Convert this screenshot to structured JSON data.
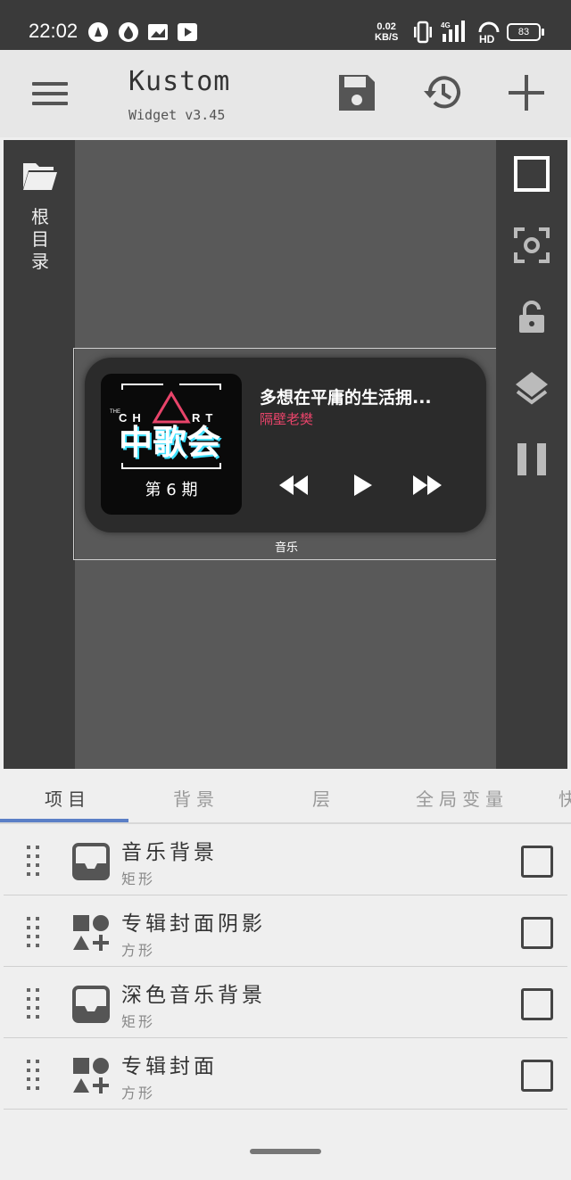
{
  "status_bar": {
    "time": "22:02",
    "net_speed_value": "0.02",
    "net_speed_unit": "KB/S",
    "battery": "83",
    "signal_label": "4G",
    "hd_label": "HD"
  },
  "app_bar": {
    "title": "Kustom",
    "subtitle": "Widget v3.45",
    "icons": [
      "menu-icon",
      "save-icon",
      "history-icon",
      "add-icon"
    ]
  },
  "editor": {
    "root_label": "根目录",
    "widget": {
      "cover_brand": "THE CHART",
      "cover_title": "中歌会",
      "cover_episode": "第 6 期",
      "song_title": "多想在平庸的生活拥...",
      "artist": "隔壁老樊",
      "label": "音乐"
    },
    "right_tools": [
      "select-box-icon",
      "focus-icon",
      "lock-icon",
      "layers-icon",
      "pause-icon"
    ]
  },
  "tabs": [
    {
      "label": "项目",
      "active": true
    },
    {
      "label": "背景",
      "active": false
    },
    {
      "label": "层",
      "active": false
    },
    {
      "label": "全局变量",
      "active": false
    },
    {
      "label": "快",
      "active": false
    }
  ],
  "items": [
    {
      "name": "音乐背景",
      "type": "矩形",
      "icon": "rectangle-icon"
    },
    {
      "name": "专辑封面阴影",
      "type": "方形",
      "icon": "shapes-icon"
    },
    {
      "name": "深色音乐背景",
      "type": "矩形",
      "icon": "rectangle-icon"
    },
    {
      "name": "专辑封面",
      "type": "方形",
      "icon": "shapes-icon"
    }
  ],
  "colors": {
    "accent": "#5b7fc6",
    "artist": "#e8446a",
    "status_bar": "#3a3a3a",
    "editor_bg": "#595959"
  }
}
